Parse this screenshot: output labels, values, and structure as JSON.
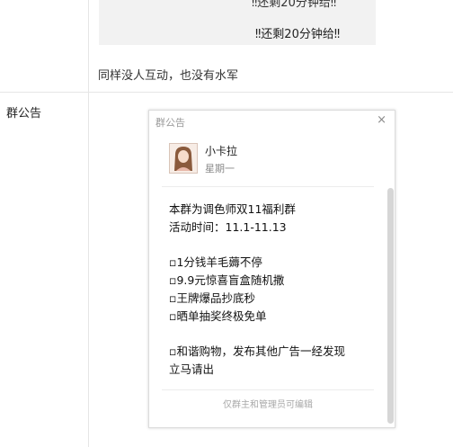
{
  "message_card": {
    "cut_text": "‼还剩20分钟给‼",
    "text": "‼还剩20分钟给‼"
  },
  "caption": "同样没人互动，也没有水军",
  "left_label": "群公告",
  "dialog": {
    "title": "群公告",
    "close": "×",
    "author": "小卡拉",
    "time": "星期一",
    "content": [
      "本群为调色师双11福利群",
      "活动时间：11.1-11.13",
      "",
      "▫1分钱羊毛薅不停",
      "▫9.9元惊喜盲盒随机撒",
      "▫王牌爆品抄底秒",
      "▫晒单抽奖终极免单",
      "",
      "▫和谐购物，发布其他广告一经发现",
      "立马请出"
    ],
    "footer": "仅群主和管理员可编辑"
  }
}
